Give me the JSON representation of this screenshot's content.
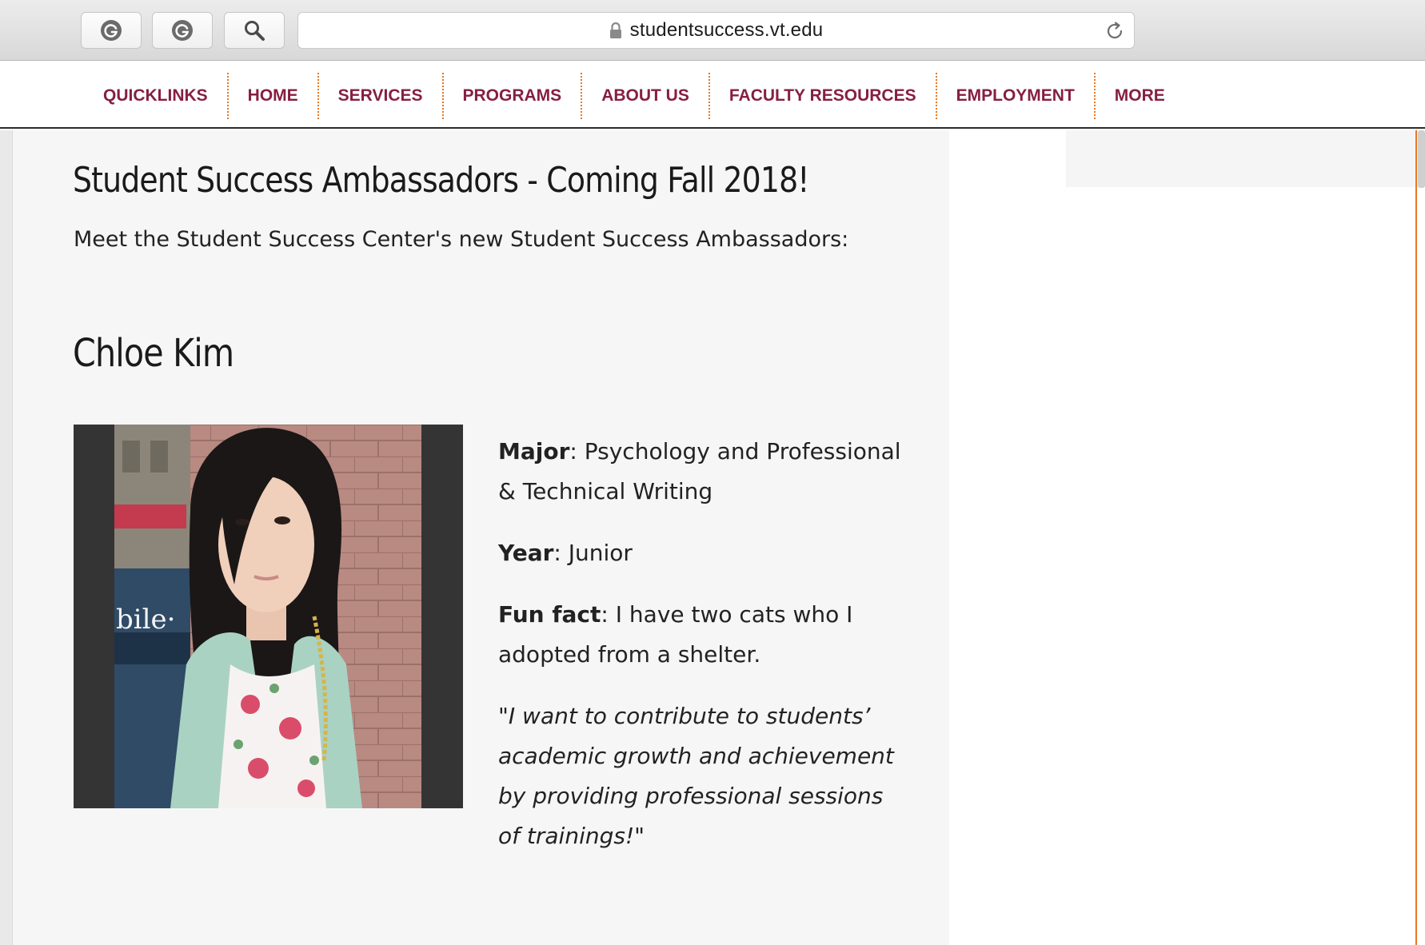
{
  "browser": {
    "url": "studentsuccess.vt.edu",
    "buttons": [
      "grammarly-extension",
      "grammarly-extension",
      "search"
    ]
  },
  "nav": {
    "items": [
      "QUICKLINKS",
      "HOME",
      "SERVICES",
      "PROGRAMS",
      "ABOUT US",
      "FACULTY RESOURCES",
      "EMPLOYMENT",
      "MORE"
    ]
  },
  "page": {
    "title": "Student Success Ambassadors - Coming Fall 2018!",
    "intro": "Meet the Student Success Center's new Student Success Ambassadors:"
  },
  "ambassador": {
    "name": "Chloe Kim",
    "photo_sign_text": "bile·",
    "major_label": "Major",
    "major": "Psychology and Professional & Technical Writing",
    "year_label": "Year",
    "year": "Junior",
    "fun_fact_label": "Fun fact",
    "fun_fact": "I have two cats who I adopted from a shelter.",
    "quote": "\"I want to contribute to students’ academic growth and achievement by providing professional sessions of trainings!\""
  },
  "colors": {
    "nav_text": "#861f41",
    "nav_separator": "#e87722",
    "accent_rule": "#e87722"
  }
}
